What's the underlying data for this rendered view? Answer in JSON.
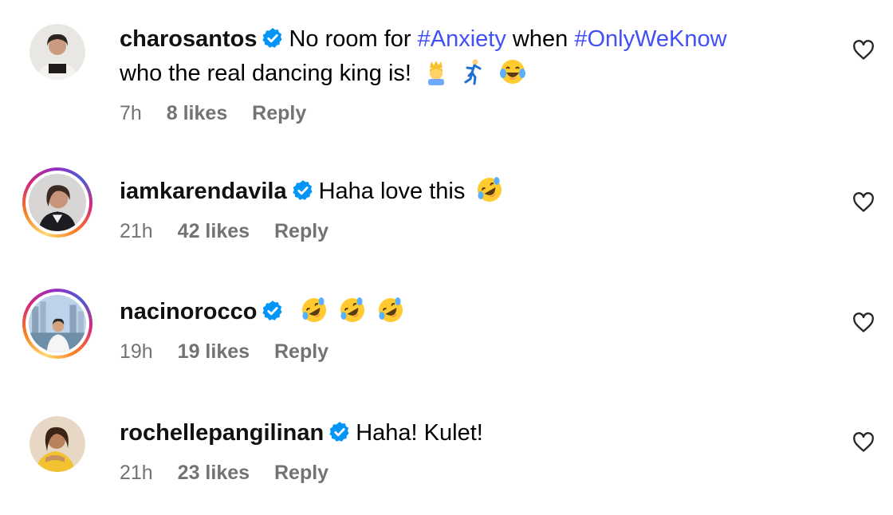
{
  "comments": [
    {
      "username": "charosantos",
      "text_segments": {
        "before_tag1": "No room for ",
        "tag1": "#Anxiety",
        "between": " when ",
        "tag2": "#OnlyWeKnow",
        "line2": "who the real dancing king is!"
      },
      "emojis": [
        "prince-emoji",
        "dancer-emoji",
        "tears-of-joy-emoji"
      ],
      "time": "7h",
      "likes": "8 likes",
      "reply": "Reply"
    },
    {
      "username": "iamkarendavila",
      "text": "Haha love this",
      "emojis": [
        "rolling-on-floor-laughing-emoji"
      ],
      "time": "21h",
      "likes": "42 likes",
      "reply": "Reply"
    },
    {
      "username": "nacinorocco",
      "text": "",
      "emojis": [
        "rolling-on-floor-laughing-emoji",
        "rolling-on-floor-laughing-emoji",
        "rolling-on-floor-laughing-emoji"
      ],
      "time": "19h",
      "likes": "19 likes",
      "reply": "Reply"
    },
    {
      "username": "rochellepangilinan",
      "text": "Haha! Kulet!",
      "emojis": [],
      "time": "21h",
      "likes": "23 likes",
      "reply": "Reply"
    }
  ],
  "colors": {
    "hashtag": "#4150f7",
    "verified": "#0095f6",
    "meta": "#737373"
  },
  "icons": [
    "verified-badge-icon",
    "heart-icon"
  ]
}
